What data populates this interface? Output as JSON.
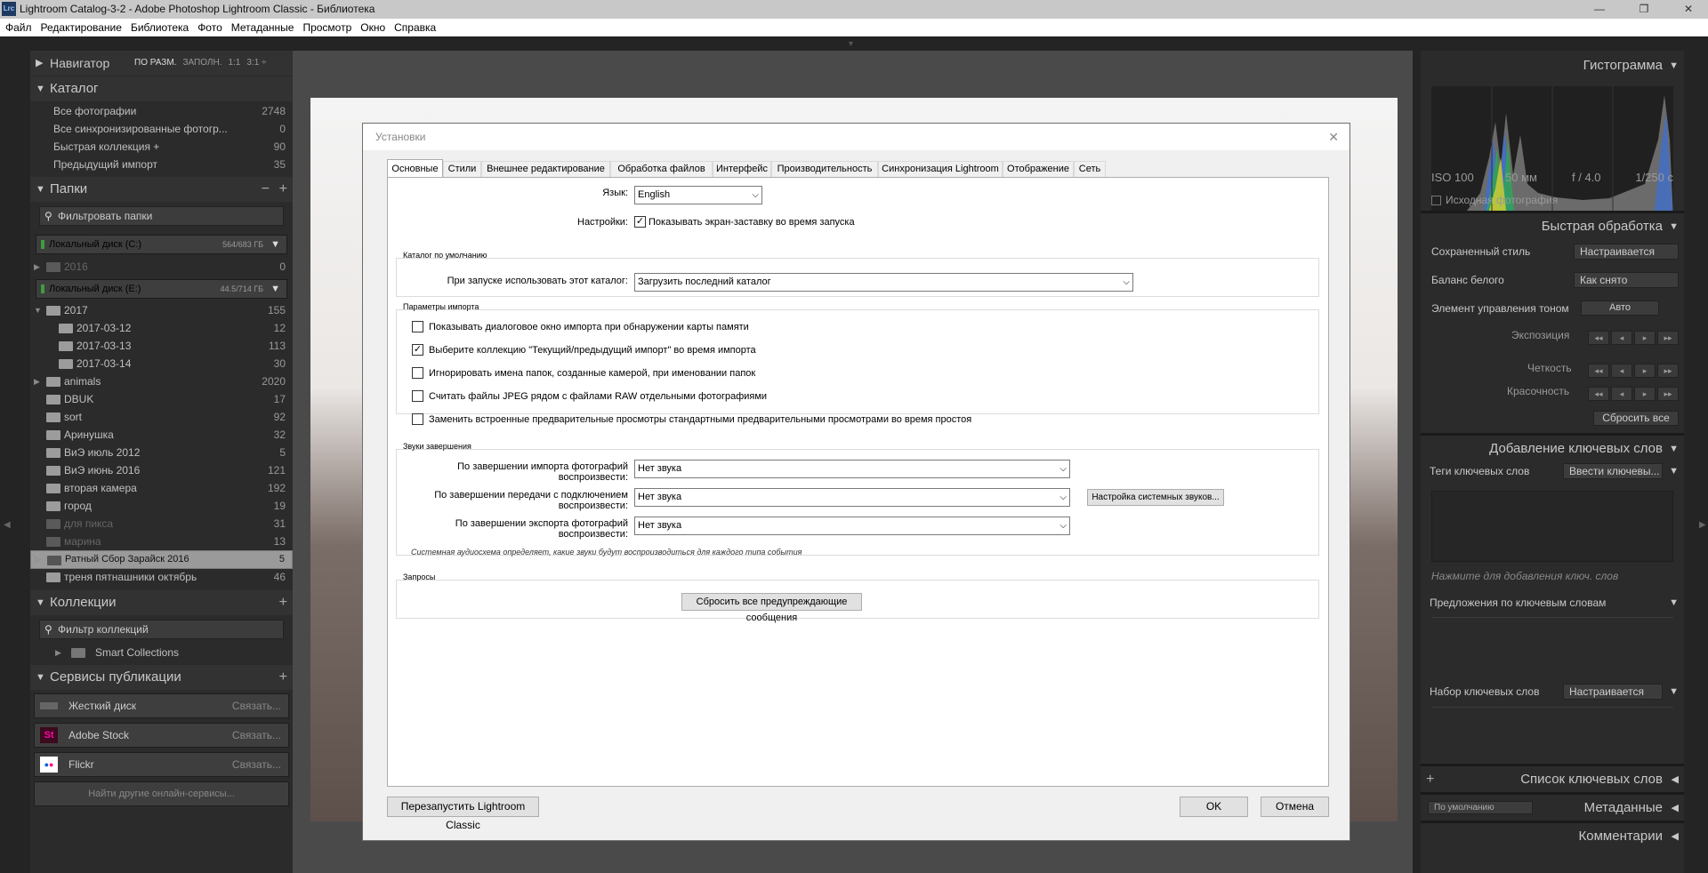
{
  "window": {
    "app_icon": "Lrc",
    "title": "Lightroom Catalog-3-2 - Adobe Photoshop Lightroom Classic - Библиотека",
    "minimize": "—",
    "maximize": "❐",
    "close": "✕"
  },
  "menu": [
    "Файл",
    "Редактирование",
    "Библиотека",
    "Фото",
    "Метаданные",
    "Просмотр",
    "Окно",
    "Справка"
  ],
  "left_panel": {
    "navigator": {
      "title": "Навигатор",
      "options": [
        "ПО РАЗМ.",
        "ЗАПОЛН.",
        "1:1",
        "3:1 ÷"
      ]
    },
    "catalog": {
      "title": "Каталог",
      "items": [
        {
          "label": "Все фотографии",
          "count": "2748"
        },
        {
          "label": "Все синхронизированные фотогр...",
          "count": "0"
        },
        {
          "label": "Быстрая коллекция  +",
          "count": "90"
        },
        {
          "label": "Предыдущий импорт",
          "count": "35"
        }
      ]
    },
    "folders": {
      "title": "Папки",
      "minus": "−",
      "plus": "+",
      "filter": "Фильтровать папки",
      "drive_c": {
        "label": "Локальный диск (C:)",
        "size": "564/683 ГБ"
      },
      "drive_c_items": [
        {
          "label": "2016",
          "count": "0"
        }
      ],
      "drive_e": {
        "label": "Локальный диск (E:)",
        "size": "44.5/714 ГБ"
      },
      "items": [
        {
          "label": "2017",
          "count": "155"
        },
        {
          "label": "2017-03-12",
          "count": "12"
        },
        {
          "label": "2017-03-13",
          "count": "113"
        },
        {
          "label": "2017-03-14",
          "count": "30"
        },
        {
          "label": "animals",
          "count": "2020"
        },
        {
          "label": "DBUK",
          "count": "17"
        },
        {
          "label": "sort",
          "count": "92"
        },
        {
          "label": "Аринушка",
          "count": "32"
        },
        {
          "label": "ВиЭ июль 2012",
          "count": "5"
        },
        {
          "label": "ВиЭ июнь 2016",
          "count": "121"
        },
        {
          "label": "вторая камера",
          "count": "192"
        },
        {
          "label": "город",
          "count": "19"
        },
        {
          "label": "для пикса",
          "count": "31"
        },
        {
          "label": "марина",
          "count": "13"
        },
        {
          "label": "Ратный Сбор Зарайск 2016",
          "count": "5"
        },
        {
          "label": "треня пятнашники октябрь",
          "count": "46"
        }
      ]
    },
    "collections": {
      "title": "Коллекции",
      "plus": "+",
      "filter": "Фильтр коллекций",
      "smart": "Smart Collections"
    },
    "publish": {
      "title": "Сервисы публикации",
      "plus": "+",
      "items": [
        {
          "label": "Жесткий диск",
          "action": "Связать..."
        },
        {
          "label": "Adobe Stock",
          "action": "Связать..."
        },
        {
          "label": "Flickr",
          "action": "Связать..."
        }
      ],
      "find": "Найти другие онлайн-сервисы..."
    }
  },
  "right_panel": {
    "histogram": {
      "title": "Гистограмма",
      "iso": "ISO 100",
      "focal": "50 мм",
      "aperture": "f / 4.0",
      "shutter": "1/250 с",
      "original": "Исходная фотография"
    },
    "quick_develop": {
      "title": "Быстрая обработка",
      "saved_style": "Сохраненный стиль",
      "saved_style_value": "Настраивается",
      "wb": "Баланс белого",
      "wb_value": "Как снято",
      "tone": "Элемент управления тоном",
      "auto": "Авто",
      "exposure": "Экспозиция",
      "clarity": "Четкость",
      "vibrance": "Красочность",
      "reset": "Сбросить все"
    },
    "keywording": {
      "title": "Добавление ключевых слов",
      "tags": "Теги ключевых слов",
      "tags_value": "Ввести ключевы...",
      "placeholder": "Нажмите для добавления ключ. слов",
      "suggestions": "Предложения по ключевым словам",
      "set": "Набор ключевых слов",
      "set_value": "Настраивается"
    },
    "keyword_list": {
      "title": "Список ключевых слов",
      "plus": "+"
    },
    "metadata": {
      "title": "Метаданные",
      "preset": "По умолчанию"
    },
    "comments": {
      "title": "Комментарии"
    }
  },
  "dialog": {
    "title": "Установки",
    "close": "✕",
    "tabs": [
      "Основные",
      "Стили",
      "Внешнее редактирование",
      "Обработка файлов",
      "Интерфейс",
      "Производительность",
      "Синхронизация Lightroom",
      "Отображение",
      "Сеть"
    ],
    "active_tab": "Основные",
    "language_label": "Язык:",
    "language_value": "English",
    "settings_label": "Настройки:",
    "splash": "Показывать экран-заставку во время запуска",
    "catalog_group": "Каталог по умолчанию",
    "catalog_label": "При запуске использовать этот каталог:",
    "catalog_value": "Загрузить последний каталог",
    "import_group": "Параметры импорта",
    "import_options": [
      {
        "label": "Показывать диалоговое окно импорта при обнаружении карты памяти",
        "checked": false
      },
      {
        "label": "Выберите коллекцию \"Текущий/предыдущий импорт\" во время импорта",
        "checked": true
      },
      {
        "label": "Игнорировать имена папок, созданные камерой, при именовании папок",
        "checked": false
      },
      {
        "label": "Считать файлы JPEG рядом с файлами RAW отдельными фотографиями",
        "checked": false
      },
      {
        "label": "Заменить встроенные предварительные просмотры стандартными предварительными просмотрами во время простоя",
        "checked": false
      }
    ],
    "sounds_group": "Звуки завершения",
    "sounds": [
      {
        "label": "По завершении импорта фотографий воспроизвести:",
        "value": "Нет звука"
      },
      {
        "label": "По завершении передачи с подключением воспроизвести:",
        "value": "Нет звука"
      },
      {
        "label": "По завершении экспорта фотографий воспроизвести:",
        "value": "Нет звука"
      }
    ],
    "system_sounds_button": "Настройка системных звуков...",
    "sounds_note": "Системная аудиосхема определяет, какие звуки будут воспроизводиться для каждого типа события",
    "prompts_group": "Запросы",
    "reset_warnings": "Сбросить все предупреждающие сообщения",
    "restart": "Перезапустить Lightroom Classic",
    "ok": "OK",
    "cancel": "Отмена"
  }
}
